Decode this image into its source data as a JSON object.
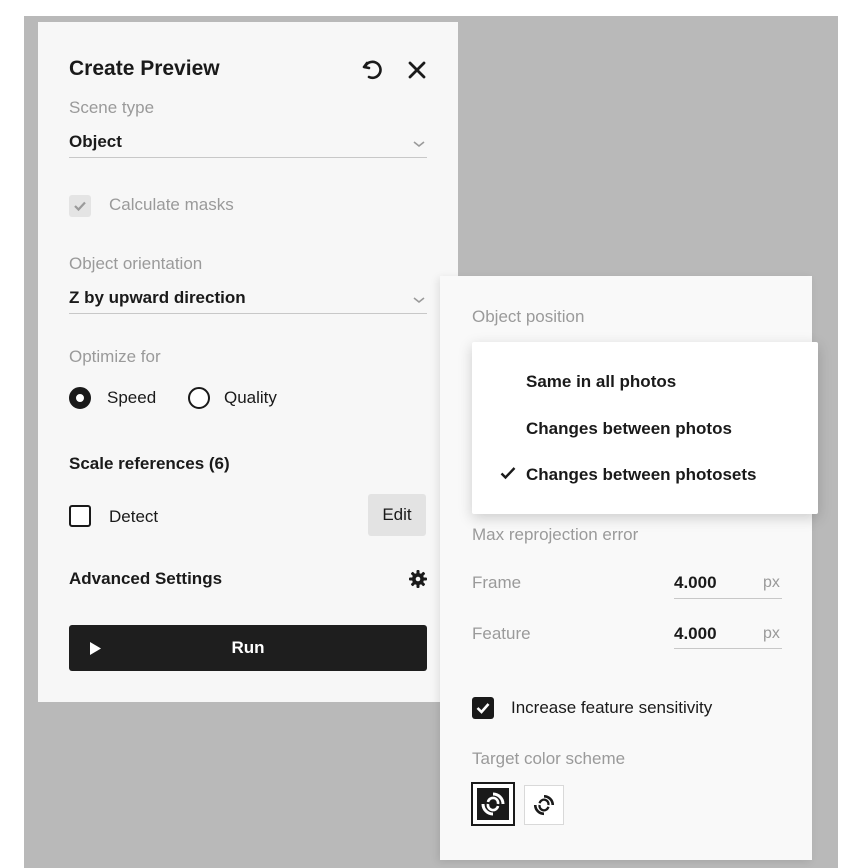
{
  "create_preview": {
    "title": "Create Preview",
    "scene_type": {
      "label": "Scene type",
      "value": "Object"
    },
    "calculate_masks": {
      "label": "Calculate masks",
      "checked": true,
      "disabled": true
    },
    "object_orientation": {
      "label": "Object orientation",
      "value": "Z by upward direction"
    },
    "optimize_for": {
      "label": "Optimize for",
      "options": [
        {
          "label": "Speed",
          "selected": true
        },
        {
          "label": "Quality",
          "selected": false
        }
      ]
    },
    "scale_references": {
      "heading": "Scale references (6)",
      "detect_label": "Detect",
      "detect_checked": false,
      "edit_label": "Edit"
    },
    "advanced_settings": {
      "label": "Advanced Settings"
    },
    "run": {
      "label": "Run"
    }
  },
  "advanced_panel": {
    "object_position": {
      "label": "Object position",
      "options": [
        {
          "label": "Same in all photos",
          "selected": false
        },
        {
          "label": "Changes between photos",
          "selected": false
        },
        {
          "label": "Changes between photosets",
          "selected": true
        }
      ]
    },
    "max_reprojection_error": {
      "label": "Max reprojection error",
      "frame": {
        "label": "Frame",
        "value": "4.000",
        "unit": "px"
      },
      "feature": {
        "label": "Feature",
        "value": "4.000",
        "unit": "px"
      }
    },
    "increase_feature_sensitivity": {
      "label": "Increase feature sensitivity",
      "checked": true
    },
    "target_color_scheme": {
      "label": "Target color scheme",
      "options": [
        {
          "icon": "target-dark-icon",
          "selected": true
        },
        {
          "icon": "target-light-icon",
          "selected": false
        }
      ]
    }
  },
  "colors": {
    "backdrop": "#b9b9b9",
    "panel": "#f7f7f7",
    "text": "#1a1a1a",
    "muted": "#9a9a9a",
    "run_button": "#1e1e1e"
  }
}
